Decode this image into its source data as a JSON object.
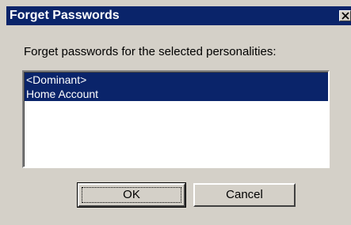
{
  "window": {
    "title": "Forget Passwords",
    "close_icon": "close-icon"
  },
  "prompt": "Forget passwords for the selected personalities:",
  "personalities": [
    {
      "label": "<Dominant>",
      "selected": true
    },
    {
      "label": "Home Account",
      "selected": true
    }
  ],
  "buttons": {
    "ok": "OK",
    "cancel": "Cancel"
  },
  "colors": {
    "titlebar": "#0a246a",
    "selection": "#0a246a",
    "face": "#d4d0c8"
  }
}
